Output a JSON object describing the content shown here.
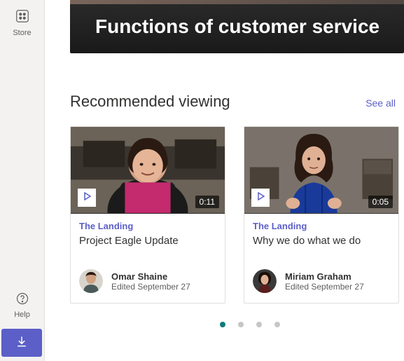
{
  "sidebar": {
    "store": {
      "label": "Store"
    },
    "help": {
      "label": "Help"
    }
  },
  "hero": {
    "title": "Functions of customer service"
  },
  "section": {
    "title": "Recommended viewing",
    "see_all": "See all"
  },
  "cards": [
    {
      "duration": "0:11",
      "category": "The Landing",
      "title": "Project Eagle Update",
      "author": "Omar Shaine",
      "edited": "Edited September 27"
    },
    {
      "duration": "0:05",
      "category": "The Landing",
      "title": "Why we do what we do",
      "author": "Miriam Graham",
      "edited": "Edited September 27"
    }
  ],
  "pagination": {
    "total": 4,
    "active": 0
  }
}
